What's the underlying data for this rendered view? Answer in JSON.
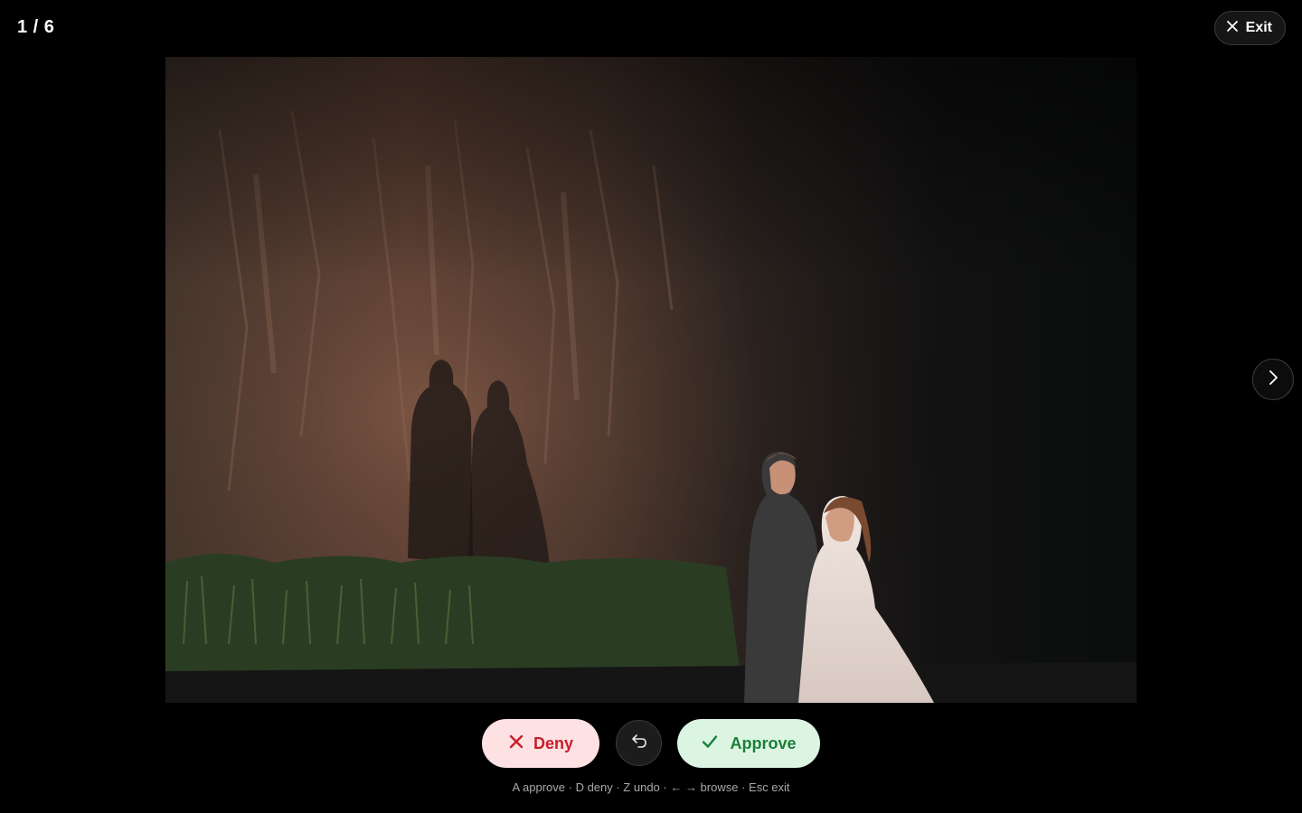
{
  "viewer": {
    "counter": "1 / 6",
    "exit_label": "Exit",
    "photo_alt": "Couple in wedding attire embracing at night in front of a lit rock cliff with their shadows cast on it"
  },
  "actions": {
    "deny_label": "Deny",
    "approve_label": "Approve",
    "undo_icon": "undo-icon"
  },
  "hint": "A approve · D deny · Z undo · ← → browse · Esc exit",
  "colors": {
    "background": "#000000",
    "deny_bg": "#fde1e3",
    "deny_fg": "#c81e2a",
    "approve_bg": "#dcf5e2",
    "approve_fg": "#1a7f3a"
  }
}
